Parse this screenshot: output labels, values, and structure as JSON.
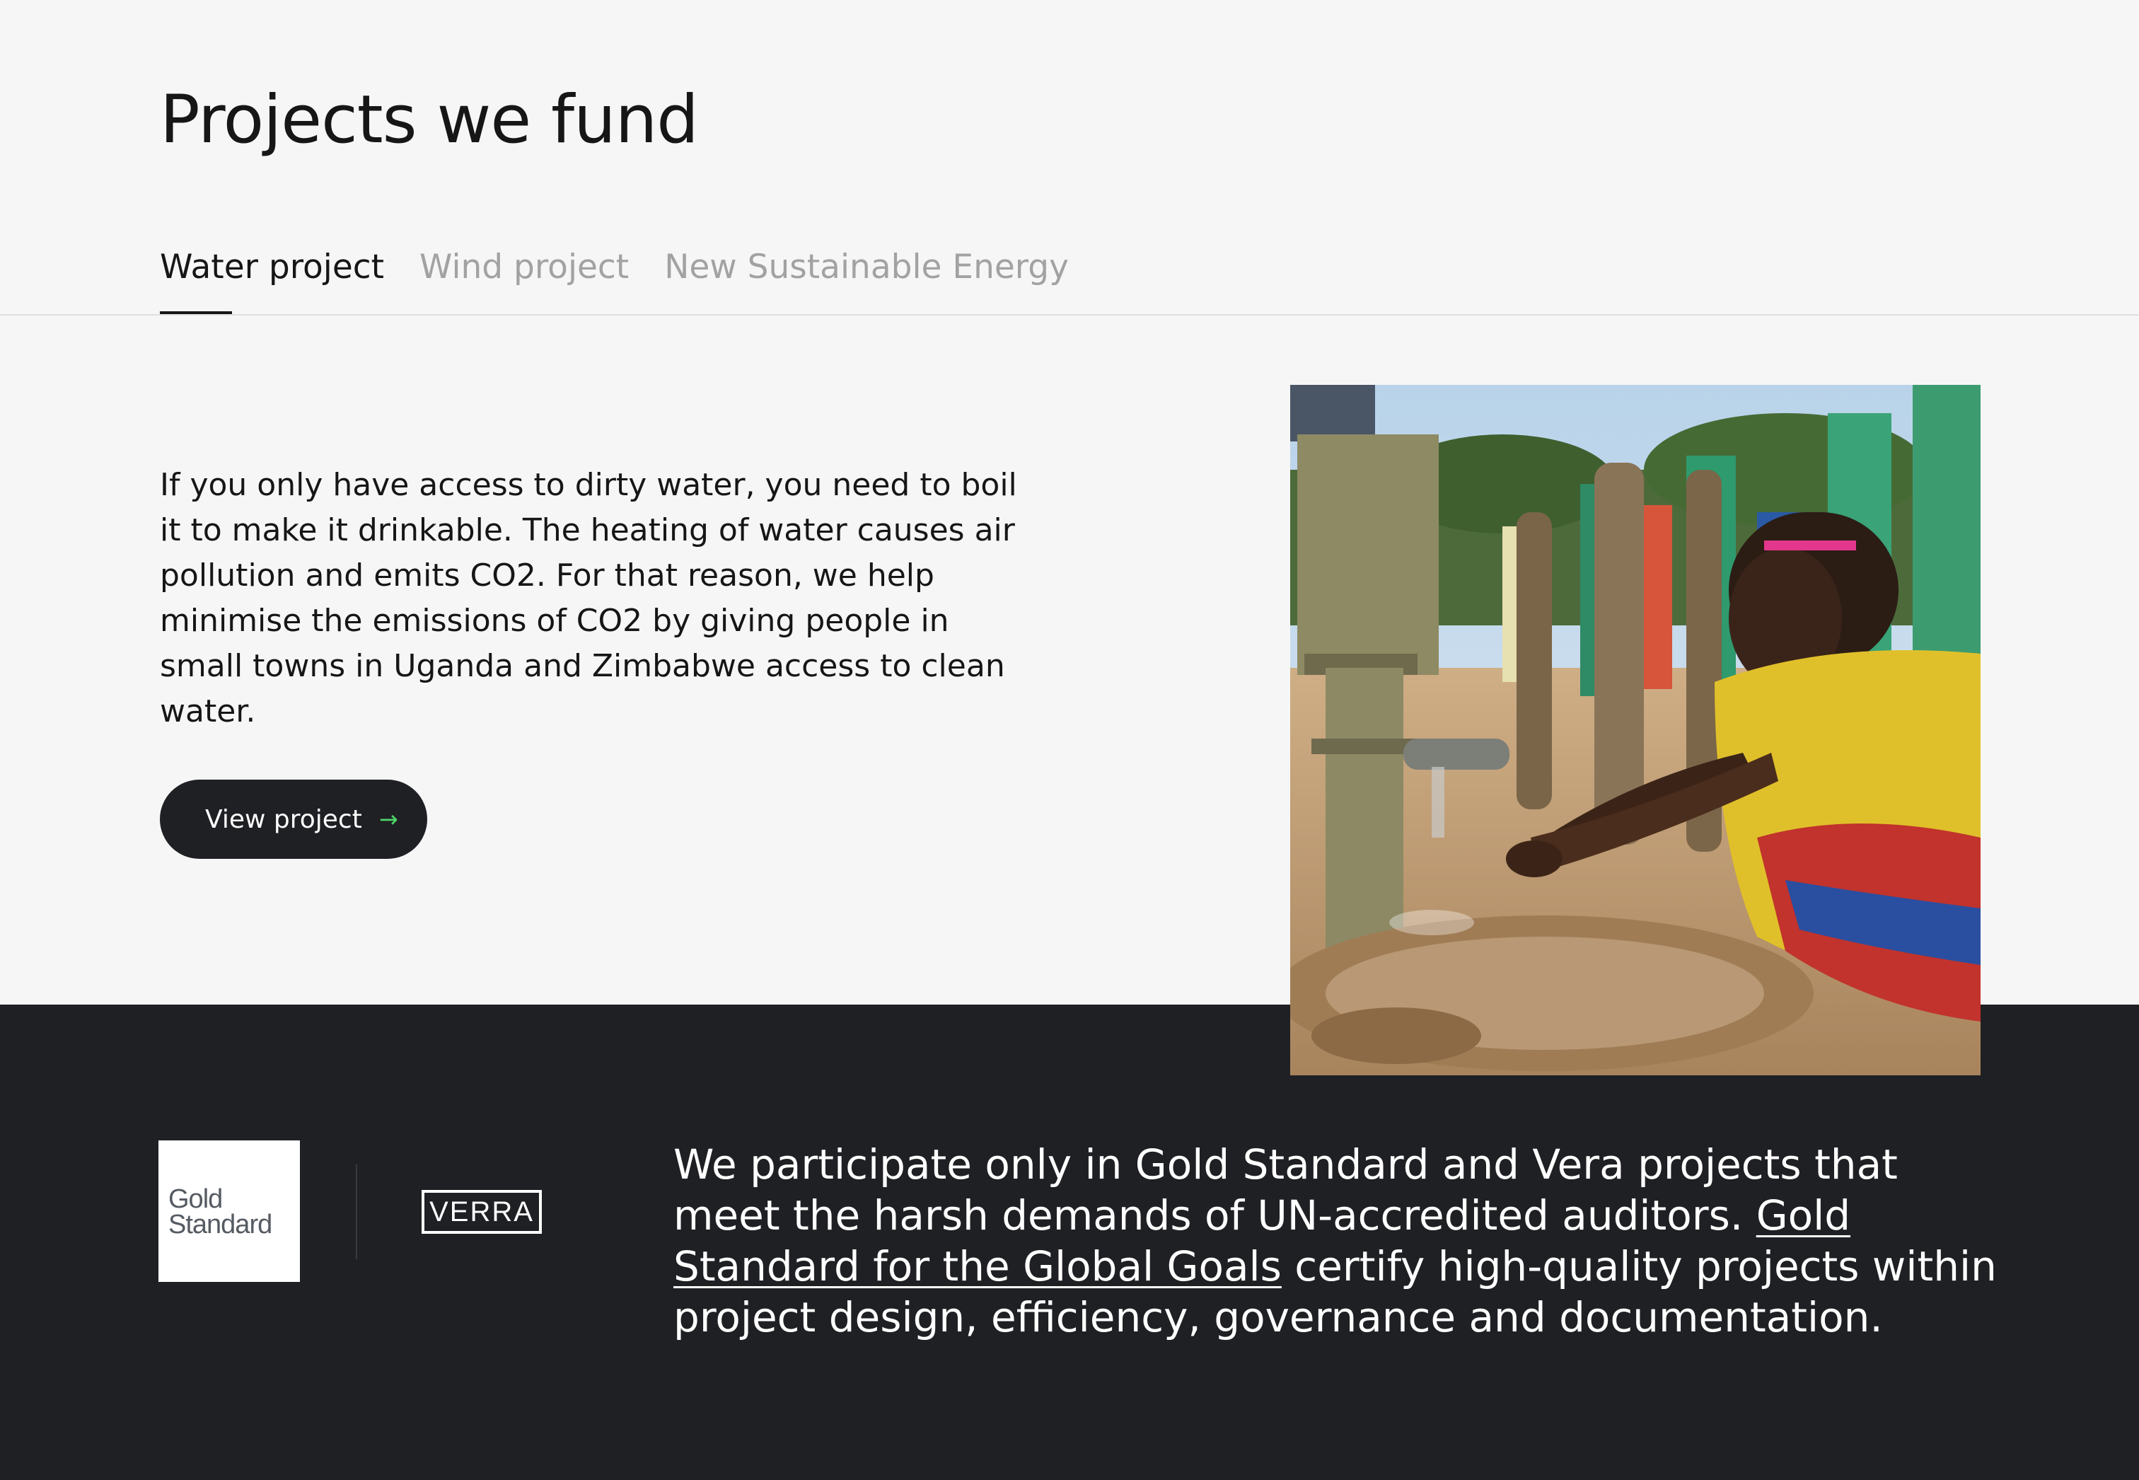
{
  "header": {
    "title": "Projects we fund"
  },
  "tabs": [
    {
      "label": "Water project",
      "active": true
    },
    {
      "label": "Wind project",
      "active": false
    },
    {
      "label": "New Sustainable Energy",
      "active": false
    }
  ],
  "project": {
    "description": "If you only have access to dirty water, you need to boil it to make it drinkable. The heating of water causes air pollution and emits CO2. For that reason, we help minimise the emissions of CO2 by giving people in small towns in Uganda and Zimbabwe access to clean water.",
    "cta_label": "View project",
    "cta_icon": "arrow-right-icon",
    "image": "photo of a woman washing her hands at a hand water pump while people gather in the background"
  },
  "footer": {
    "logos": {
      "gold_standard_line1": "Gold",
      "gold_standard_line2": "Standard",
      "verra": "VERRA"
    },
    "text_before_link": "We participate only in Gold Standard and Vera projects that meet the harsh demands of UN-accredited auditors. ",
    "link_label": "Gold Standard for the Global Goals",
    "text_after_link": " certify high-quality projects within project design, efficiency, governance and documentation."
  },
  "colors": {
    "background": "#f6f6f6",
    "dark": "#1f2024",
    "text": "#161616",
    "tab_inactive": "#a2a2a2",
    "accent_arrow": "#4ed66a"
  }
}
